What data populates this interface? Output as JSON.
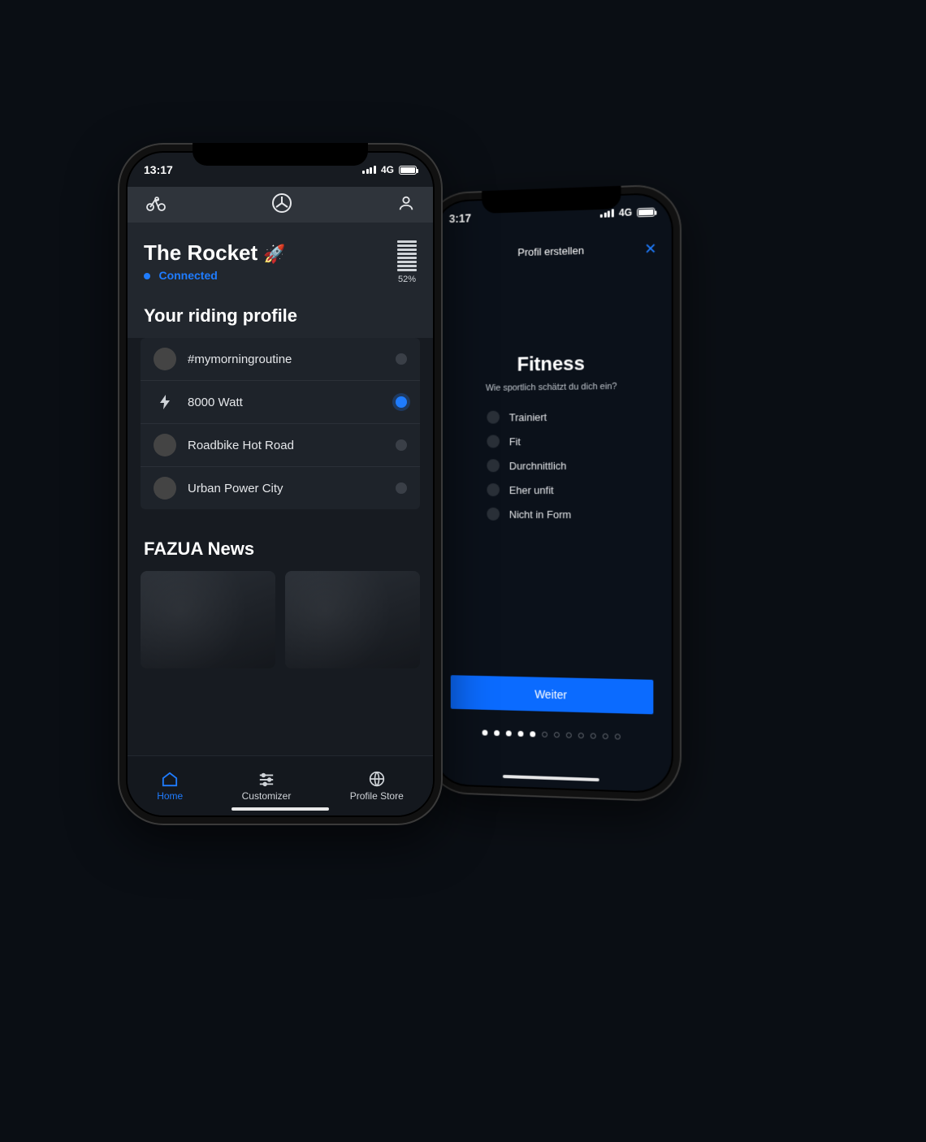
{
  "left": {
    "status": {
      "time": "13:17",
      "net": "4G"
    },
    "device": {
      "name": "The Rocket",
      "emoji": "🚀",
      "connection": "Connected",
      "battery_pct": "52%"
    },
    "profile_heading": "Your riding profile",
    "profiles": [
      {
        "label": "#mymorningroutine",
        "icon": "avatar",
        "selected": false
      },
      {
        "label": "8000 Watt",
        "icon": "bolt",
        "selected": true
      },
      {
        "label": "Roadbike Hot Road",
        "icon": "avatar",
        "selected": false
      },
      {
        "label": "Urban Power City",
        "icon": "avatar",
        "selected": false
      }
    ],
    "news_heading": "FAZUA News",
    "tabs": [
      {
        "label": "Home",
        "active": true
      },
      {
        "label": "Customizer",
        "active": false
      },
      {
        "label": "Profile Store",
        "active": false
      }
    ]
  },
  "right": {
    "status": {
      "time": "3:17",
      "net": "4G"
    },
    "header": "Profil erstellen",
    "title": "Fitness",
    "subtitle": "Wie sportlich schätzt du dich ein?",
    "options": [
      "Trainiert",
      "Fit",
      "Durchnittlich",
      "Eher unfit",
      "Nicht in Form"
    ],
    "cta": "Weiter",
    "progress": {
      "total": 12,
      "filled": 5
    }
  }
}
